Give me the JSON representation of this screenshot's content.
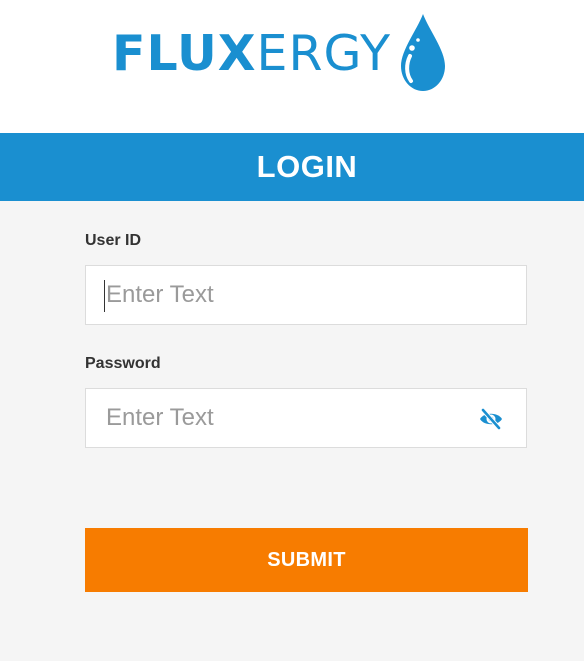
{
  "brand": {
    "name_bold": "FLUX",
    "name_light": "ERGY",
    "color": "#1a8fd0"
  },
  "login": {
    "title": "LOGIN",
    "header_color": "#1a8fd0",
    "user_id": {
      "label": "User ID",
      "placeholder": "Enter Text",
      "value": ""
    },
    "password": {
      "label": "Password",
      "placeholder": "Enter Text",
      "value": "",
      "toggle_icon": "eye-off-icon"
    },
    "submit": {
      "label": "SUBMIT",
      "color": "#f77c00"
    }
  }
}
